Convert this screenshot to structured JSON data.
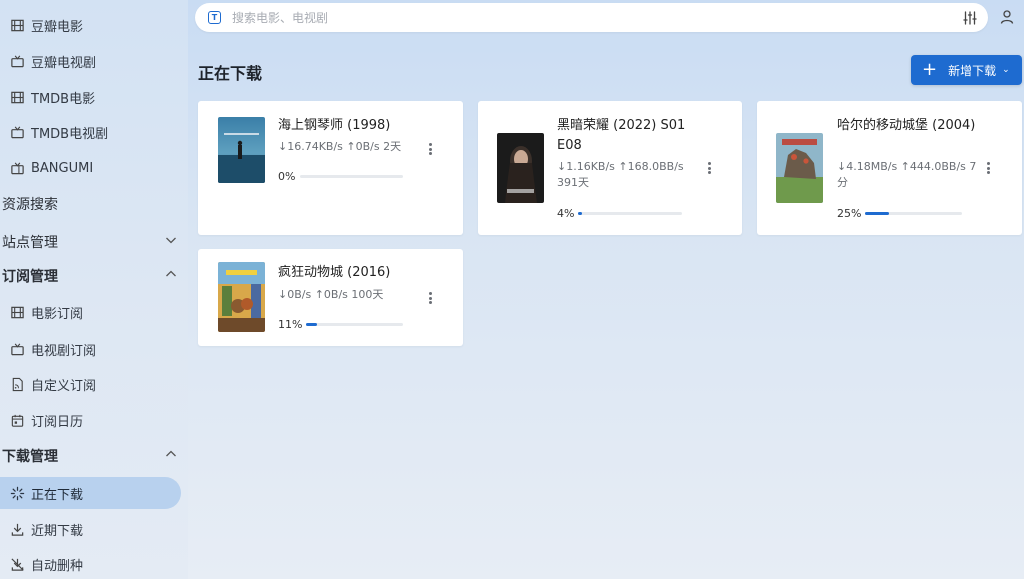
{
  "sidebar": {
    "items_top": [
      {
        "label": "豆瓣电影",
        "icon": "film-icon"
      },
      {
        "label": "豆瓣电视剧",
        "icon": "tv-icon"
      },
      {
        "label": "TMDB电影",
        "icon": "film-icon"
      },
      {
        "label": "TMDB电视剧",
        "icon": "tv-icon"
      },
      {
        "label": "BANGUMI",
        "icon": "tv-retro-icon"
      }
    ],
    "resource_search": "资源搜索",
    "site_manage": "站点管理",
    "subscribe_manage": "订阅管理",
    "subscribe_items": [
      {
        "label": "电影订阅",
        "icon": "film-icon"
      },
      {
        "label": "电视剧订阅",
        "icon": "tv-icon"
      },
      {
        "label": "自定义订阅",
        "icon": "rss-file-icon"
      },
      {
        "label": "订阅日历",
        "icon": "calendar-icon"
      }
    ],
    "download_manage": "下载管理",
    "download_items": [
      {
        "label": "正在下载",
        "icon": "loading-icon",
        "active": true
      },
      {
        "label": "近期下载",
        "icon": "download-icon"
      },
      {
        "label": "自动删种",
        "icon": "delete-seed-icon"
      }
    ]
  },
  "search": {
    "placeholder": "搜索电影、电视剧"
  },
  "header": {
    "title": "正在下载",
    "add_label": "新增下载"
  },
  "downloads": [
    {
      "title": "海上钢琴师 (1998)",
      "speed": "↓16.74KB/s ↑0B/s 2天",
      "percent_label": "0%",
      "progress": 0
    },
    {
      "title": "黑暗荣耀 (2022) S01 E08",
      "speed": "↓1.16KB/s ↑168.0BB/s 391天",
      "percent_label": "4%",
      "progress": 4
    },
    {
      "title": "哈尔的移动城堡 (2004)",
      "speed": "↓4.18MB/s ↑444.0BB/s 7分",
      "percent_label": "25%",
      "progress": 25
    },
    {
      "title": "疯狂动物城 (2016)",
      "speed": "↓0B/s ↑0B/s 100天",
      "percent_label": "11%",
      "progress": 11
    }
  ],
  "colors": {
    "accent": "#1e6bd0",
    "active_nav": "#b8d1ee"
  }
}
